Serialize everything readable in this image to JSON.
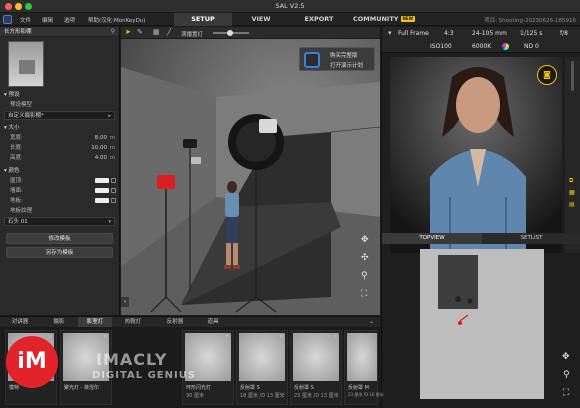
{
  "window": {
    "title": "SAL V2.5"
  },
  "menu": {
    "items": [
      "文件",
      "编辑",
      "选项",
      "帮助(汉化:MonKeyDu)"
    ]
  },
  "top_tabs": [
    {
      "label": "SETUP"
    },
    {
      "label": "VIEW"
    },
    {
      "label": "EXPORT"
    },
    {
      "label": "COMMUNITY",
      "badge": "NEW"
    }
  ],
  "project_name": "项目: Shooting-20230626-185916",
  "left_panel": {
    "title": "长方形影棚",
    "presets_title": "预设",
    "presets_label": "预设模型",
    "preset_value": "自定义摄影棚*",
    "size_title": "大小",
    "size": [
      {
        "label": "宽度:",
        "value": "8.00",
        "unit": "m"
      },
      {
        "label": "长度:",
        "value": "10.00",
        "unit": "m"
      },
      {
        "label": "高度:",
        "value": "4.00",
        "unit": "m"
      }
    ],
    "colors_title": "颜色",
    "colors": [
      {
        "label": "屋顶:"
      },
      {
        "label": "墙面:"
      },
      {
        "label": "地板:"
      }
    ],
    "texture_label": "地板纹理",
    "texture_value": "石头 01",
    "edit_button": "修改模板",
    "save_button": "另存为模板"
  },
  "viewport": {
    "slider_label": "滴播置灯",
    "menu_items": [
      "购买完整版",
      "打开演示计划"
    ]
  },
  "camera": {
    "sensor": "Full Frame",
    "aspect": "4:3",
    "lens": "24-105 mm",
    "shutter": "1/125 s",
    "aperture": "f/8",
    "iso": "ISO100",
    "white_balance": "6000K",
    "nd": "ND 0"
  },
  "view_tabs": [
    "TOPVIEW",
    "SETLIST"
  ],
  "categories": [
    "对讲器",
    "摄影",
    "影室灯",
    "热靴灯",
    "反射器",
    "道具"
  ],
  "active_category": 2,
  "shelf": [
    {
      "name": "模特",
      "spec": ""
    },
    {
      "name": "聚光灯 - 菲涅尔",
      "spec": ""
    },
    {
      "name": "环形闪光灯",
      "spec": "30 厘米"
    },
    {
      "name": "反射罩 S",
      "spec": "18 厘米 /D 13 厘米"
    },
    {
      "name": "反射罩 S",
      "spec": "23 厘米 /D 13 厘米"
    },
    {
      "name": "反射罩 M",
      "spec": "23 厘米 /D 16 厘米"
    }
  ],
  "watermark": {
    "logo": "iM",
    "word": "IMACLY",
    "sub": "DIGITAL GENIUS"
  },
  "colors": {
    "accent": "#f0c419",
    "badge": "#e2232a"
  }
}
